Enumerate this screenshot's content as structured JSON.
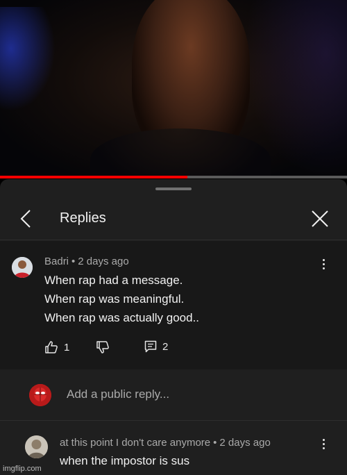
{
  "video": {
    "progress": 0.54,
    "progress_color": "#ff0000"
  },
  "header": {
    "title": "Replies",
    "back_icon": "chevron-left-icon",
    "close_icon": "close-icon"
  },
  "top_comment": {
    "author": "Badri",
    "separator": "•",
    "time": "2 days ago",
    "lines": [
      "When rap had a message.",
      "When rap was meaningful.",
      "When rap was actually good.."
    ],
    "likes": "1",
    "replies": "2"
  },
  "reply_box": {
    "placeholder": "Add a public reply..."
  },
  "reply": {
    "author": "at this point I don't care anymore",
    "separator": "•",
    "time": "2 days ago",
    "text": "when the impostor is sus"
  },
  "watermark": "imgflip.com",
  "colors": {
    "sheet": "#1f1f1f",
    "comment_bg": "#181818",
    "muted_text": "#aaaaaa",
    "text": "#f1f1f1"
  }
}
